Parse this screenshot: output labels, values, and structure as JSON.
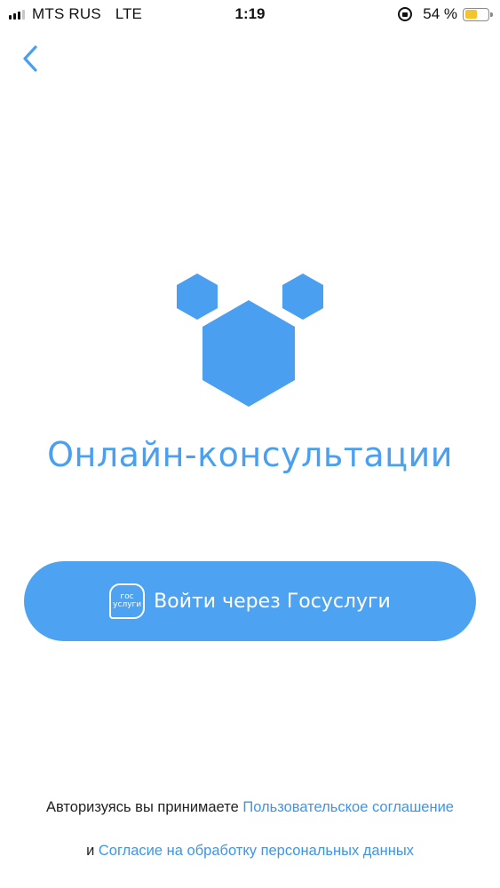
{
  "status_bar": {
    "carrier": "MTS RUS",
    "network": "LTE",
    "time": "1:19",
    "battery_percent": "54 %",
    "icons": [
      "signal-icon",
      "orientation-lock-icon",
      "battery-icon"
    ]
  },
  "header": {
    "back_icon": "chevron-left-icon"
  },
  "app": {
    "title": "Онлайн-консультации",
    "accent_color": "#4a9ff0"
  },
  "login_button": {
    "badge_line1": "гос",
    "badge_line2": "услуги",
    "label": "Войти через Госуслуги",
    "background": "#4da3f2"
  },
  "legal": {
    "prefix": "Авторизуясь вы принимаете ",
    "user_agreement_link": "Пользовательское соглашение",
    "conjunction": "и ",
    "consent_link": "Согласие на обработку персональных данных",
    "link_color": "#3e95e8"
  }
}
